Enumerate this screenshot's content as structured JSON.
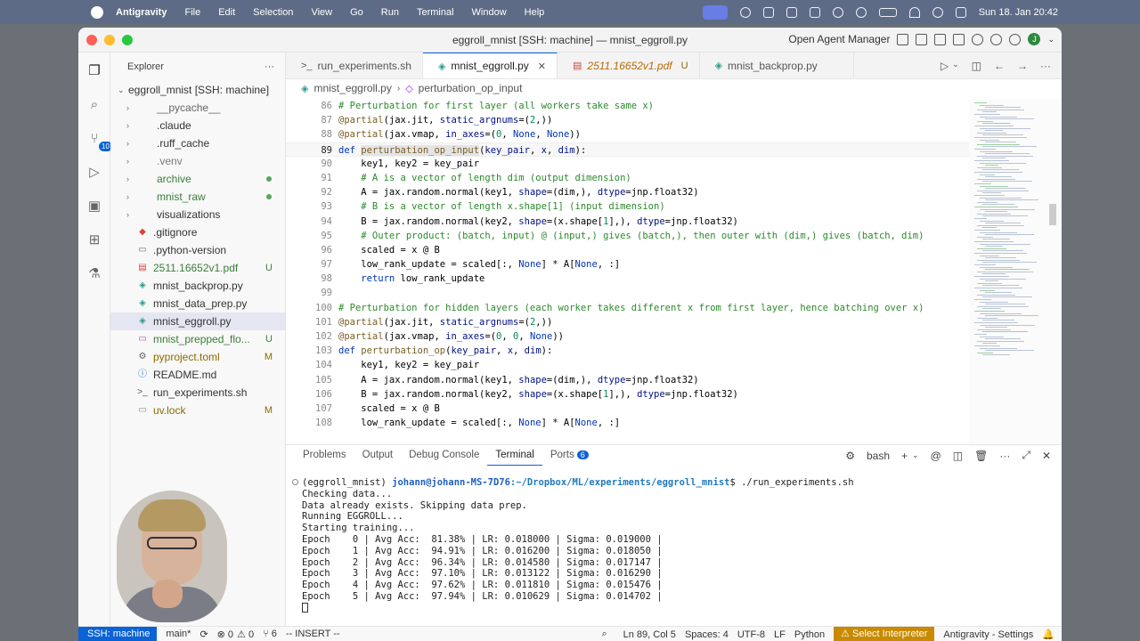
{
  "menubar": {
    "app": "Antigravity",
    "items": [
      "File",
      "Edit",
      "Selection",
      "View",
      "Go",
      "Run",
      "Terminal",
      "Window",
      "Help"
    ],
    "clock": "Sun 18. Jan  20:42"
  },
  "window": {
    "title": "eggroll_mnist [SSH: machine] — mnist_eggroll.py",
    "agent_manager": "Open Agent Manager",
    "avatar_letter": "J"
  },
  "activity": {
    "badge": "10"
  },
  "sidebar": {
    "header": "Explorer",
    "more": "···",
    "root": "eggroll_mnist [SSH: machine]",
    "items": [
      {
        "label": "__pycache__",
        "type": "folder",
        "color": "#666"
      },
      {
        "label": ".claude",
        "type": "folder",
        "color": "#333"
      },
      {
        "label": ".ruff_cache",
        "type": "folder",
        "color": "#333"
      },
      {
        "label": ".venv",
        "type": "folder",
        "color": "#777"
      },
      {
        "label": "archive",
        "type": "folder",
        "color": "#3a7d3a",
        "dot": true
      },
      {
        "label": "mnist_raw",
        "type": "folder",
        "color": "#3a7d3a",
        "dot": true
      },
      {
        "label": "visualizations",
        "type": "folder",
        "color": "#333"
      },
      {
        "label": ".gitignore",
        "type": "file",
        "icon": "◆",
        "iconColor": "#d9443b",
        "color": "#333"
      },
      {
        "label": ".python-version",
        "type": "file",
        "icon": "▭",
        "iconColor": "#666",
        "color": "#333"
      },
      {
        "label": "2511.16652v1.pdf",
        "type": "file",
        "icon": "▤",
        "iconColor": "#d9443b",
        "color": "#3a7d3a",
        "mark": "U"
      },
      {
        "label": "mnist_backprop.py",
        "type": "file",
        "icon": "◈",
        "iconColor": "#2b9c8f",
        "color": "#333"
      },
      {
        "label": "mnist_data_prep.py",
        "type": "file",
        "icon": "◈",
        "iconColor": "#2b9c8f",
        "color": "#333"
      },
      {
        "label": "mnist_eggroll.py",
        "type": "file",
        "icon": "◈",
        "iconColor": "#2b9c8f",
        "color": "#333",
        "selected": true
      },
      {
        "label": "mnist_prepped_flo...",
        "type": "file",
        "icon": "▭",
        "iconColor": "#b04bb0",
        "color": "#3a7d3a",
        "mark": "U"
      },
      {
        "label": "pyproject.toml",
        "type": "file",
        "icon": "⚙",
        "iconColor": "#666",
        "color": "#8b6b00",
        "mark": "M"
      },
      {
        "label": "README.md",
        "type": "file",
        "icon": "ⓘ",
        "iconColor": "#1f60c0",
        "color": "#333"
      },
      {
        "label": "run_experiments.sh",
        "type": "file",
        "icon": ">_",
        "iconColor": "#555",
        "color": "#333"
      },
      {
        "label": "uv.lock",
        "type": "file",
        "icon": "▭",
        "iconColor": "#888",
        "color": "#8b6b00",
        "mark": "M"
      }
    ]
  },
  "tabs": [
    {
      "label": "run_experiments.sh",
      "icon": ">_"
    },
    {
      "label": "mnist_eggroll.py",
      "icon": "◈",
      "active": true,
      "close": "✕"
    },
    {
      "label": "2511.16652v1.pdf",
      "icon": "▤",
      "pdf": true,
      "mod": "U"
    },
    {
      "label": "mnist_backprop.py",
      "icon": "◈"
    }
  ],
  "breadcrumbs": {
    "file": "mnist_eggroll.py",
    "symbol": "perturbation_op_input"
  },
  "code": {
    "current_line": 89,
    "lines": [
      {
        "n": 86,
        "t": [
          [
            "c-com",
            "# Perturbation for first layer (all workers take same x)"
          ]
        ]
      },
      {
        "n": 87,
        "t": [
          [
            "c-dec",
            "@partial"
          ],
          [
            "",
            "(jax.jit, "
          ],
          [
            "c-param",
            "static_argnums"
          ],
          [
            "",
            "=("
          ],
          [
            "c-num",
            "2"
          ],
          [
            "",
            ",))"
          ]
        ]
      },
      {
        "n": 88,
        "t": [
          [
            "c-dec",
            "@partial"
          ],
          [
            "",
            "(jax.vmap, "
          ],
          [
            "c-param",
            "in_axes"
          ],
          [
            "",
            "=("
          ],
          [
            "c-num",
            "0"
          ],
          [
            "",
            ", "
          ],
          [
            "c-none",
            "None"
          ],
          [
            "",
            ", "
          ],
          [
            "c-none",
            "None"
          ],
          [
            "",
            "))"
          ]
        ]
      },
      {
        "n": 89,
        "t": [
          [
            "c-kw",
            "def "
          ],
          [
            "c-fn hl-word",
            "perturbation_op_input"
          ],
          [
            "",
            "("
          ],
          [
            "c-param",
            "key_pair"
          ],
          [
            "",
            ", "
          ],
          [
            "c-param",
            "x"
          ],
          [
            "",
            ", "
          ],
          [
            "c-param",
            "dim"
          ],
          [
            "",
            "):"
          ]
        ]
      },
      {
        "n": 90,
        "t": [
          [
            "",
            "    key1, key2 = key_pair"
          ]
        ]
      },
      {
        "n": 91,
        "t": [
          [
            "c-com",
            "    # A is a vector of length dim (output dimension)"
          ]
        ]
      },
      {
        "n": 92,
        "t": [
          [
            "",
            "    A = jax.random.normal(key1, "
          ],
          [
            "c-param",
            "shape"
          ],
          [
            "",
            "=(dim,), "
          ],
          [
            "c-param",
            "dtype"
          ],
          [
            "",
            "=jnp.float32)"
          ]
        ]
      },
      {
        "n": 93,
        "t": [
          [
            "c-com",
            "    # B is a vector of length x.shape[1] (input dimension)"
          ]
        ]
      },
      {
        "n": 94,
        "t": [
          [
            "",
            "    B = jax.random.normal(key2, "
          ],
          [
            "c-param",
            "shape"
          ],
          [
            "",
            "=(x.shape["
          ],
          [
            "c-num",
            "1"
          ],
          [
            "",
            "],), "
          ],
          [
            "c-param",
            "dtype"
          ],
          [
            "",
            "=jnp.float32)"
          ]
        ]
      },
      {
        "n": 95,
        "t": [
          [
            "c-com",
            "    # Outer product: (batch, input) @ (input,) gives (batch,), then outer with (dim,) gives (batch, dim)"
          ]
        ]
      },
      {
        "n": 96,
        "t": [
          [
            "",
            "    scaled = x @ B"
          ]
        ]
      },
      {
        "n": 97,
        "t": [
          [
            "",
            "    low_rank_update = scaled[:, "
          ],
          [
            "c-none",
            "None"
          ],
          [
            "",
            "] * A["
          ],
          [
            "c-none",
            "None"
          ],
          [
            "",
            ", :]"
          ]
        ]
      },
      {
        "n": 98,
        "t": [
          [
            "",
            "    "
          ],
          [
            "c-kw",
            "return"
          ],
          [
            "",
            " low_rank_update"
          ]
        ]
      },
      {
        "n": 99,
        "t": [
          [
            "",
            ""
          ]
        ]
      },
      {
        "n": 100,
        "t": [
          [
            "c-com",
            "# Perturbation for hidden layers (each worker takes different x from first layer, hence batching over x)"
          ]
        ]
      },
      {
        "n": 101,
        "t": [
          [
            "c-dec",
            "@partial"
          ],
          [
            "",
            "(jax.jit, "
          ],
          [
            "c-param",
            "static_argnums"
          ],
          [
            "",
            "=("
          ],
          [
            "c-num",
            "2"
          ],
          [
            "",
            ",))"
          ]
        ]
      },
      {
        "n": 102,
        "t": [
          [
            "c-dec",
            "@partial"
          ],
          [
            "",
            "(jax.vmap, "
          ],
          [
            "c-param",
            "in_axes"
          ],
          [
            "",
            "=("
          ],
          [
            "c-num",
            "0"
          ],
          [
            "",
            ", "
          ],
          [
            "c-num",
            "0"
          ],
          [
            "",
            ", "
          ],
          [
            "c-none",
            "None"
          ],
          [
            "",
            "))"
          ]
        ]
      },
      {
        "n": 103,
        "t": [
          [
            "c-kw",
            "def "
          ],
          [
            "c-fn",
            "perturbation_op"
          ],
          [
            "",
            "("
          ],
          [
            "c-param",
            "key_pair"
          ],
          [
            "",
            ", "
          ],
          [
            "c-param",
            "x"
          ],
          [
            "",
            ", "
          ],
          [
            "c-param",
            "dim"
          ],
          [
            "",
            "):"
          ]
        ]
      },
      {
        "n": 104,
        "t": [
          [
            "",
            "    key1, key2 = key_pair"
          ]
        ]
      },
      {
        "n": 105,
        "t": [
          [
            "",
            "    A = jax.random.normal(key1, "
          ],
          [
            "c-param",
            "shape"
          ],
          [
            "",
            "=(dim,), "
          ],
          [
            "c-param",
            "dtype"
          ],
          [
            "",
            "=jnp.float32)"
          ]
        ]
      },
      {
        "n": 106,
        "t": [
          [
            "",
            "    B = jax.random.normal(key2, "
          ],
          [
            "c-param",
            "shape"
          ],
          [
            "",
            "=(x.shape["
          ],
          [
            "c-num",
            "1"
          ],
          [
            "",
            "],), "
          ],
          [
            "c-param",
            "dtype"
          ],
          [
            "",
            "=jnp.float32)"
          ]
        ]
      },
      {
        "n": 107,
        "t": [
          [
            "",
            "    scaled = x @ B"
          ]
        ]
      },
      {
        "n": 108,
        "t": [
          [
            "",
            "    low_rank_update = scaled[:, "
          ],
          [
            "c-none",
            "None"
          ],
          [
            "",
            "] * A["
          ],
          [
            "c-none",
            "None"
          ],
          [
            "",
            ", :]"
          ]
        ]
      }
    ]
  },
  "panel": {
    "tabs": [
      "Problems",
      "Output",
      "Debug Console",
      "Terminal",
      "Ports"
    ],
    "active_tab": "Terminal",
    "ports_count": "6",
    "shell": "bash",
    "terminal": {
      "prompt_env": "(eggroll_mnist) ",
      "prompt_user": "johann@johann-MS-7D76",
      "prompt_path": ":~/Dropbox/ML/experiments/eggroll_mnist",
      "prompt_cmd": "$ ./run_experiments.sh",
      "lines": [
        "Checking data...",
        "Data already exists. Skipping data prep.",
        "Running EGGROLL...",
        "Starting training...",
        "Epoch    0 | Avg Acc:  81.38% | LR: 0.018000 | Sigma: 0.019000 |",
        "Epoch    1 | Avg Acc:  94.91% | LR: 0.016200 | Sigma: 0.018050 |",
        "Epoch    2 | Avg Acc:  96.34% | LR: 0.014580 | Sigma: 0.017147 |",
        "Epoch    3 | Avg Acc:  97.10% | LR: 0.013122 | Sigma: 0.016290 |",
        "Epoch    4 | Avg Acc:  97.62% | LR: 0.011810 | Sigma: 0.015476 |",
        "Epoch    5 | Avg Acc:  97.94% | LR: 0.010629 | Sigma: 0.014702 |"
      ]
    }
  },
  "statusbar": {
    "remote": "SSH: machine",
    "branch": "main*",
    "errors": "⊗ 0",
    "warnings": "⚠ 0",
    "ports": "⑂ 6",
    "mode": "-- INSERT --",
    "position": "Ln 89, Col 5",
    "spaces": "Spaces: 4",
    "encoding": "UTF-8",
    "eol": "LF",
    "language": "Python",
    "interpreter": "⚠ Select Interpreter",
    "settings": "Antigravity - Settings"
  }
}
